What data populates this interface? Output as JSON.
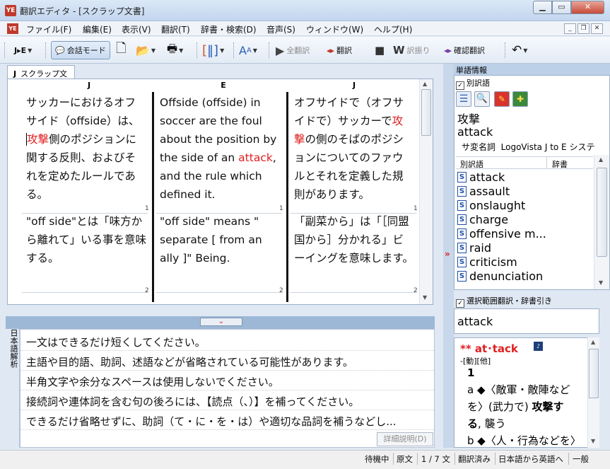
{
  "window": {
    "title": "翻訳エディタ - [スクラップ文書]",
    "app_icon_text": "YE"
  },
  "menu": [
    "ファイル(F)",
    "編集(E)",
    "表示(V)",
    "翻訳(T)",
    "辞書・検索(D)",
    "音声(S)",
    "ウィンドウ(W)",
    "ヘルプ(H)"
  ],
  "toolbar": {
    "direction": "J▸E",
    "chat_mode": "会話モード",
    "translate_all": "全翻訳",
    "translate": "翻訳",
    "distribute": "訳振り",
    "confirm_translate": "確認翻訳"
  },
  "document": {
    "tab_label": "スクラップ文書",
    "tab_prefix": "J",
    "columns": [
      "J",
      "E",
      "J"
    ],
    "rows": [
      {
        "num": "1",
        "src_pre": "サッカーにおけるオフサイド（offside）は、",
        "src_red": "攻撃",
        "src_post": "側のポジションに関する反則、およびそれを定めたルールである。",
        "en_pre": "Offside (offside) in soccer are the foul about the position by the side of an ",
        "en_red": "attack",
        "en_post": ", and the rule which defined it.",
        "back_pre": "オフサイドで（オフサイドで）サッカーで",
        "back_red": "攻撃",
        "back_post": "の側のそばのポジションについてのファウルとそれを定義した規則があります。"
      },
      {
        "num": "2",
        "src": "\"off side\"とは「味方から離れて」いる事を意味する。",
        "en": "\"off side\" means \" separate [ from an ally ]\" Being.",
        "back": "「副菜から」は「［同盟国から］分かれる」ビーイングを意味します。"
      }
    ]
  },
  "analysis": {
    "side_label": "日本語解析",
    "messages": [
      "一文はできるだけ短くしてください。",
      "主語や目的語、助詞、述語などが省略されている可能性があります。",
      "半角文字や余分なスペースは使用しないでください。",
      "接続詞や連体詞を含む句の後ろには、【読点（、）】を補ってください。",
      "できるだけ省略せずに、助詞（て・に・を・は）や適切な品詞を補うなどし..."
    ],
    "detail_button": "詳細説明(D)"
  },
  "word_info": {
    "header": "単語情報",
    "alt_words_label": "別訳語",
    "word_ja": "攻撃",
    "word_en": "attack",
    "pos": "サ変名詞",
    "dict_name": "LogoVista J to E システ",
    "list_headers": [
      "別訳語",
      "辞書"
    ],
    "alternatives": [
      "attack",
      "assault",
      "onslaught",
      "charge",
      "offensive m...",
      "raid",
      "criticism",
      "denunciation"
    ],
    "badge": "S"
  },
  "dictionary": {
    "header": "選択範囲翻訳・辞書引き",
    "query": "attack",
    "entry_headword": "** at･tack",
    "entry_pos": "-[動][他]",
    "sense_num": "1",
    "sense_a_1": "a ◆〈敵軍・敵陣など",
    "sense_a_2_pre": "を〉(武力で) ",
    "sense_a_2_bold": "攻撃す",
    "sense_a_3_bold": "る",
    "sense_a_3_post": ", 襲う",
    "sense_b": "b ◆〈人・行為などを〉"
  },
  "status": [
    "待機中",
    "原文",
    "1 / 7 文",
    "翻訳済み",
    "日本語から英語へ",
    "一般"
  ],
  "colors": {
    "highlight": "#e02020",
    "accent": "#9db8d6"
  }
}
